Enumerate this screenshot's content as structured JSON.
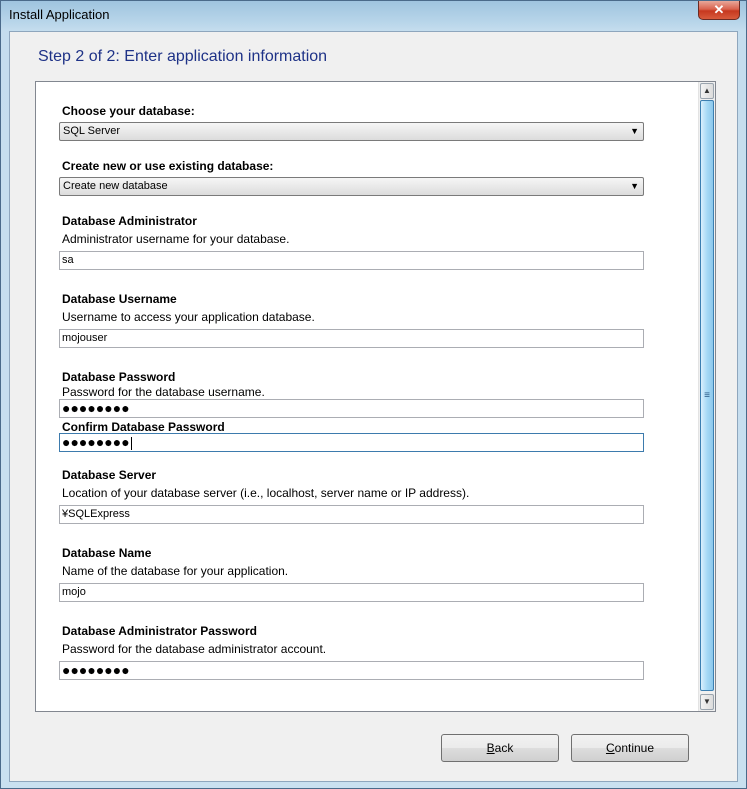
{
  "window": {
    "title": "Install Application",
    "close_glyph": "✕"
  },
  "step_title": "Step 2 of 2: Enter application information",
  "fields": {
    "database": {
      "label": "Choose your database:",
      "value": "SQL Server"
    },
    "create_db": {
      "label": "Create new or use existing database:",
      "value": "Create new database"
    },
    "db_admin": {
      "label": "Database Administrator",
      "description": "Administrator username for your database.",
      "value": "sa"
    },
    "db_username": {
      "label": "Database Username",
      "description": "Username to access your application database.",
      "value": "mojouser"
    },
    "db_password": {
      "label": "Database Password",
      "description": "Password for the database username.",
      "value": "●●●●●●●●"
    },
    "confirm_password": {
      "label": "Confirm Database Password",
      "value": "●●●●●●●●"
    },
    "db_server": {
      "label": "Database Server",
      "description": "Location of your database server (i.e., localhost, server name or IP address).",
      "value": "¥SQLExpress"
    },
    "db_name": {
      "label": "Database Name",
      "description": "Name of the database for your application.",
      "value": "mojo"
    },
    "db_admin_password": {
      "label": "Database Administrator Password",
      "description": "Password for the database administrator account.",
      "value": "●●●●●●●●"
    }
  },
  "buttons": {
    "back": {
      "mnemonic": "B",
      "rest": "ack"
    },
    "continue": {
      "mnemonic": "C",
      "rest": "ontinue"
    }
  },
  "icons": {
    "dropdown": "chevron-down-icon",
    "scroll_up": "arrow-up-icon",
    "scroll_down": "arrow-down-icon"
  }
}
